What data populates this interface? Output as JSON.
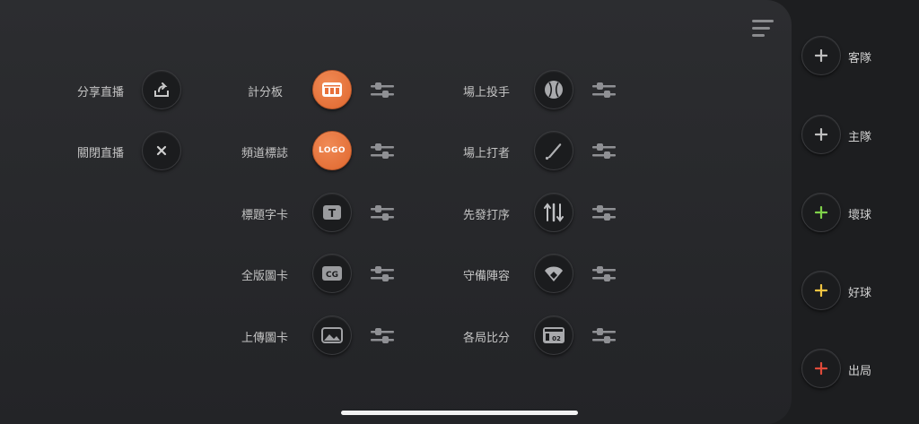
{
  "broadcast": {
    "share_label": "分享直播",
    "close_label": "關閉直播"
  },
  "overlays_left": [
    {
      "label": "計分板",
      "icon": "scoreboard-icon",
      "active": true
    },
    {
      "label": "頻道標誌",
      "icon": "logo-icon",
      "active": true,
      "icon_text": "LOGO"
    },
    {
      "label": "標題字卡",
      "icon": "title-card-icon",
      "icon_text": "T"
    },
    {
      "label": "全版圖卡",
      "icon": "cg-icon",
      "icon_text": "CG"
    },
    {
      "label": "上傳圖卡",
      "icon": "image-upload-icon"
    }
  ],
  "overlays_right": [
    {
      "label": "場上投手",
      "icon": "baseball-icon"
    },
    {
      "label": "場上打者",
      "icon": "bat-icon"
    },
    {
      "label": "先發打序",
      "icon": "lineup-icon"
    },
    {
      "label": "守備陣容",
      "icon": "field-icon"
    },
    {
      "label": "各局比分",
      "icon": "inning-score-icon",
      "icon_text": "02"
    }
  ],
  "counters": [
    {
      "label": "客隊",
      "color": "#bfbfbf"
    },
    {
      "label": "主隊",
      "color": "#bfbfbf"
    },
    {
      "label": "壞球",
      "color": "#7fd14a"
    },
    {
      "label": "好球",
      "color": "#f2c542"
    },
    {
      "label": "出局",
      "color": "#e04a3a"
    }
  ],
  "colors": {
    "accent": "#e8703a",
    "panel": "#2a2b2e"
  }
}
